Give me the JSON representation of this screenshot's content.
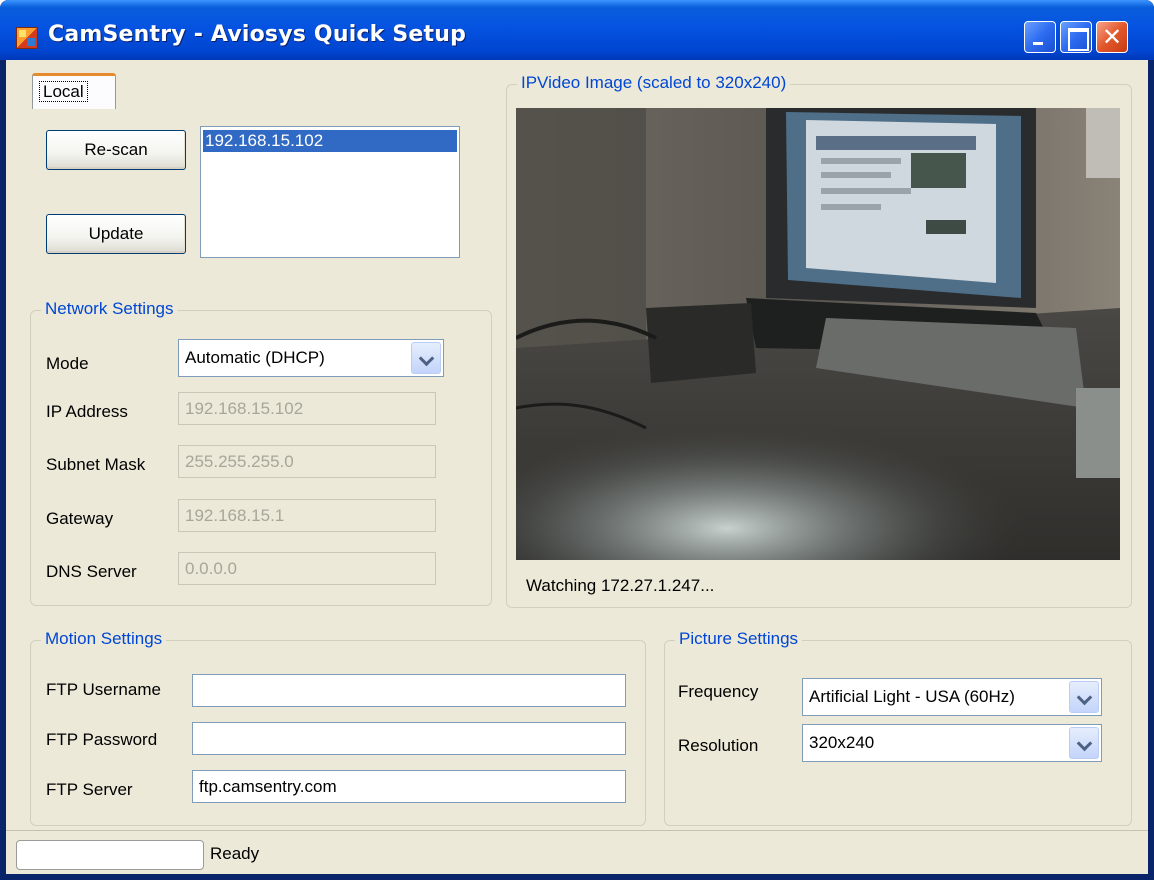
{
  "window": {
    "title": "CamSentry - Aviosys Quick Setup",
    "close_glyph": "✕"
  },
  "tabs": [
    {
      "label": "Local",
      "selected": true
    }
  ],
  "buttons": {
    "rescan": "Re-scan",
    "update": "Update"
  },
  "devices": {
    "items": [
      "192.168.15.102"
    ],
    "selected_index": 0
  },
  "network": {
    "title": "Network Settings",
    "mode_label": "Mode",
    "mode_value": "Automatic (DHCP)",
    "ip_label": "IP Address",
    "ip_value": "192.168.15.102",
    "subnet_label": "Subnet Mask",
    "subnet_value": "255.255.255.0",
    "gateway_label": "Gateway",
    "gateway_value": "192.168.15.1",
    "dns_label": "DNS Server",
    "dns_value": "0.0.0.0"
  },
  "video": {
    "title": "IPVideo Image (scaled to 320x240)",
    "status": "Watching 172.27.1.247..."
  },
  "motion": {
    "title": "Motion Settings",
    "user_label": "FTP Username",
    "user_value": "",
    "pass_label": "FTP Password",
    "pass_value": "",
    "server_label": "FTP Server",
    "server_value": "ftp.camsentry.com"
  },
  "picture": {
    "title": "Picture Settings",
    "freq_label": "Frequency",
    "freq_value": "Artificial Light - USA (60Hz)",
    "res_label": "Resolution",
    "res_value": "320x240"
  },
  "status": {
    "text": "Ready",
    "progress": 0
  },
  "colors": {
    "titlebar": "#0553e1",
    "face": "#ece9d8",
    "group_title": "#0046d5",
    "selection": "#316ac5"
  }
}
